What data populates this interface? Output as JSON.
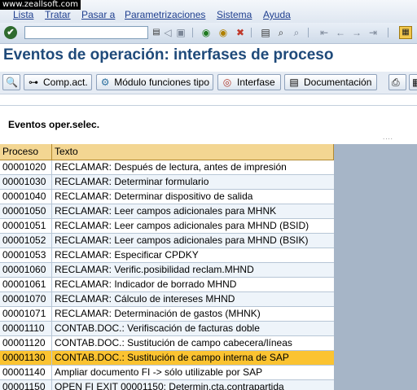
{
  "watermark": "www.zeallsoft.com",
  "menu": [
    "Lista",
    "Tratar",
    "Pasar a",
    "Parametrizaciones",
    "Sistema",
    "Ayuda"
  ],
  "command_field": {
    "value": ""
  },
  "toolbar_icons": [
    "enter-icon",
    "save-icon",
    "back-icon",
    "exit-icon",
    "cancel-icon",
    "print-icon",
    "find-icon",
    "find-next-icon",
    "first-page-icon",
    "previous-page-icon",
    "next-page-icon",
    "last-page-icon",
    "help-icon"
  ],
  "page_title": "Eventos de operación: interfases de proceso",
  "app_toolbar": {
    "comp_act": "Comp.act.",
    "modulo": "Módulo funciones tipo",
    "interfase": "Interfase",
    "documentacion": "Documentación"
  },
  "label": "Eventos oper.selec.",
  "dots": "....",
  "table": {
    "headers": [
      "Proceso",
      "Texto"
    ],
    "selected_index": 13,
    "rows": [
      {
        "code": "00001020",
        "text": "RECLAMAR: Después de lectura, antes de impresión"
      },
      {
        "code": "00001030",
        "text": "RECLAMAR: Determinar formulario"
      },
      {
        "code": "00001040",
        "text": "RECLAMAR: Determinar dispositivo de salida"
      },
      {
        "code": "00001050",
        "text": "RECLAMAR: Leer campos adicionales para MHNK"
      },
      {
        "code": "00001051",
        "text": "RECLAMAR: Leer campos adicionales para MHND (BSID)"
      },
      {
        "code": "00001052",
        "text": "RECLAMAR: Leer campos adicionales para MHND (BSIK)"
      },
      {
        "code": "00001053",
        "text": "RECLAMAR: Especificar CPDKY"
      },
      {
        "code": "00001060",
        "text": "RECLAMAR: Verific.posibilidad reclam.MHND"
      },
      {
        "code": "00001061",
        "text": "RECLAMAR: Indicador de borrado MHND"
      },
      {
        "code": "00001070",
        "text": "RECLAMAR: Cálculo de intereses MHND"
      },
      {
        "code": "00001071",
        "text": "RECLAMAR: Determinación de gastos (MHNK)"
      },
      {
        "code": "00001110",
        "text": "CONTAB.DOC.:    Verifiscación de facturas doble"
      },
      {
        "code": "00001120",
        "text": "CONTAB.DOC.: Sustitución de campo cabecera/líneas"
      },
      {
        "code": "00001130",
        "text": "CONTAB.DOC.: Sustitución de campo interna de SAP"
      },
      {
        "code": "00001140",
        "text": "Ampliar documento FI -> sólo utilizable por SAP"
      },
      {
        "code": "00001150",
        "text": "OPEN FI EXIT 00001150: Determin.cta.contrapartida"
      }
    ]
  }
}
